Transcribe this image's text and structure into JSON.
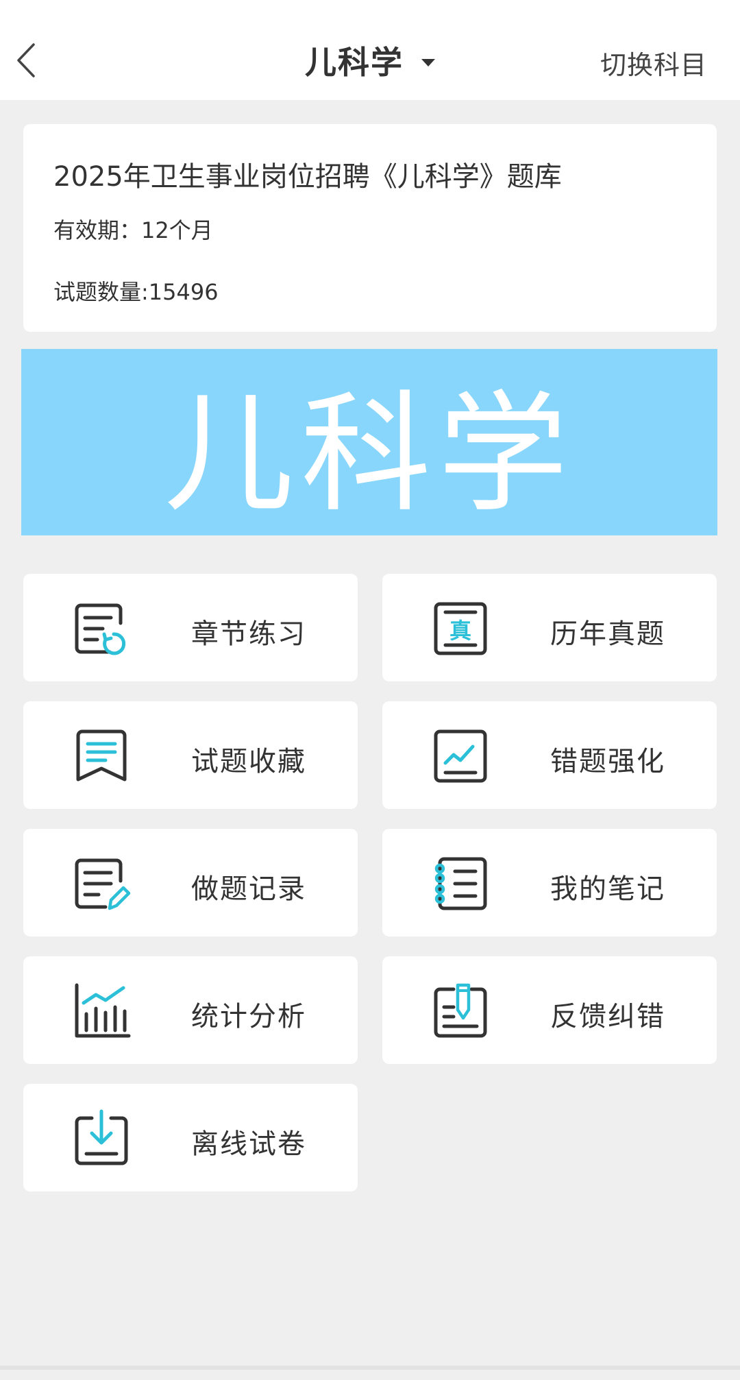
{
  "header": {
    "title": "儿科学",
    "switch_label": "切换科目"
  },
  "info": {
    "bank_title": "2025年卫生事业岗位招聘《儿科学》题库",
    "validity": "有效期：12个月",
    "count": "试题数量:15496"
  },
  "banner": {
    "text": "儿科学",
    "bg_color": "#88d6fb"
  },
  "accent_color": "#2bc0d8",
  "menu": [
    {
      "label": "章节练习",
      "icon": "chapter-practice-icon"
    },
    {
      "label": "历年真题",
      "icon": "past-exams-icon"
    },
    {
      "label": "试题收藏",
      "icon": "favorites-icon"
    },
    {
      "label": "错题强化",
      "icon": "wrong-questions-icon"
    },
    {
      "label": "做题记录",
      "icon": "practice-record-icon"
    },
    {
      "label": "我的笔记",
      "icon": "notes-icon"
    },
    {
      "label": "统计分析",
      "icon": "statistics-icon"
    },
    {
      "label": "反馈纠错",
      "icon": "feedback-icon"
    },
    {
      "label": "离线试卷",
      "icon": "offline-papers-icon"
    }
  ]
}
